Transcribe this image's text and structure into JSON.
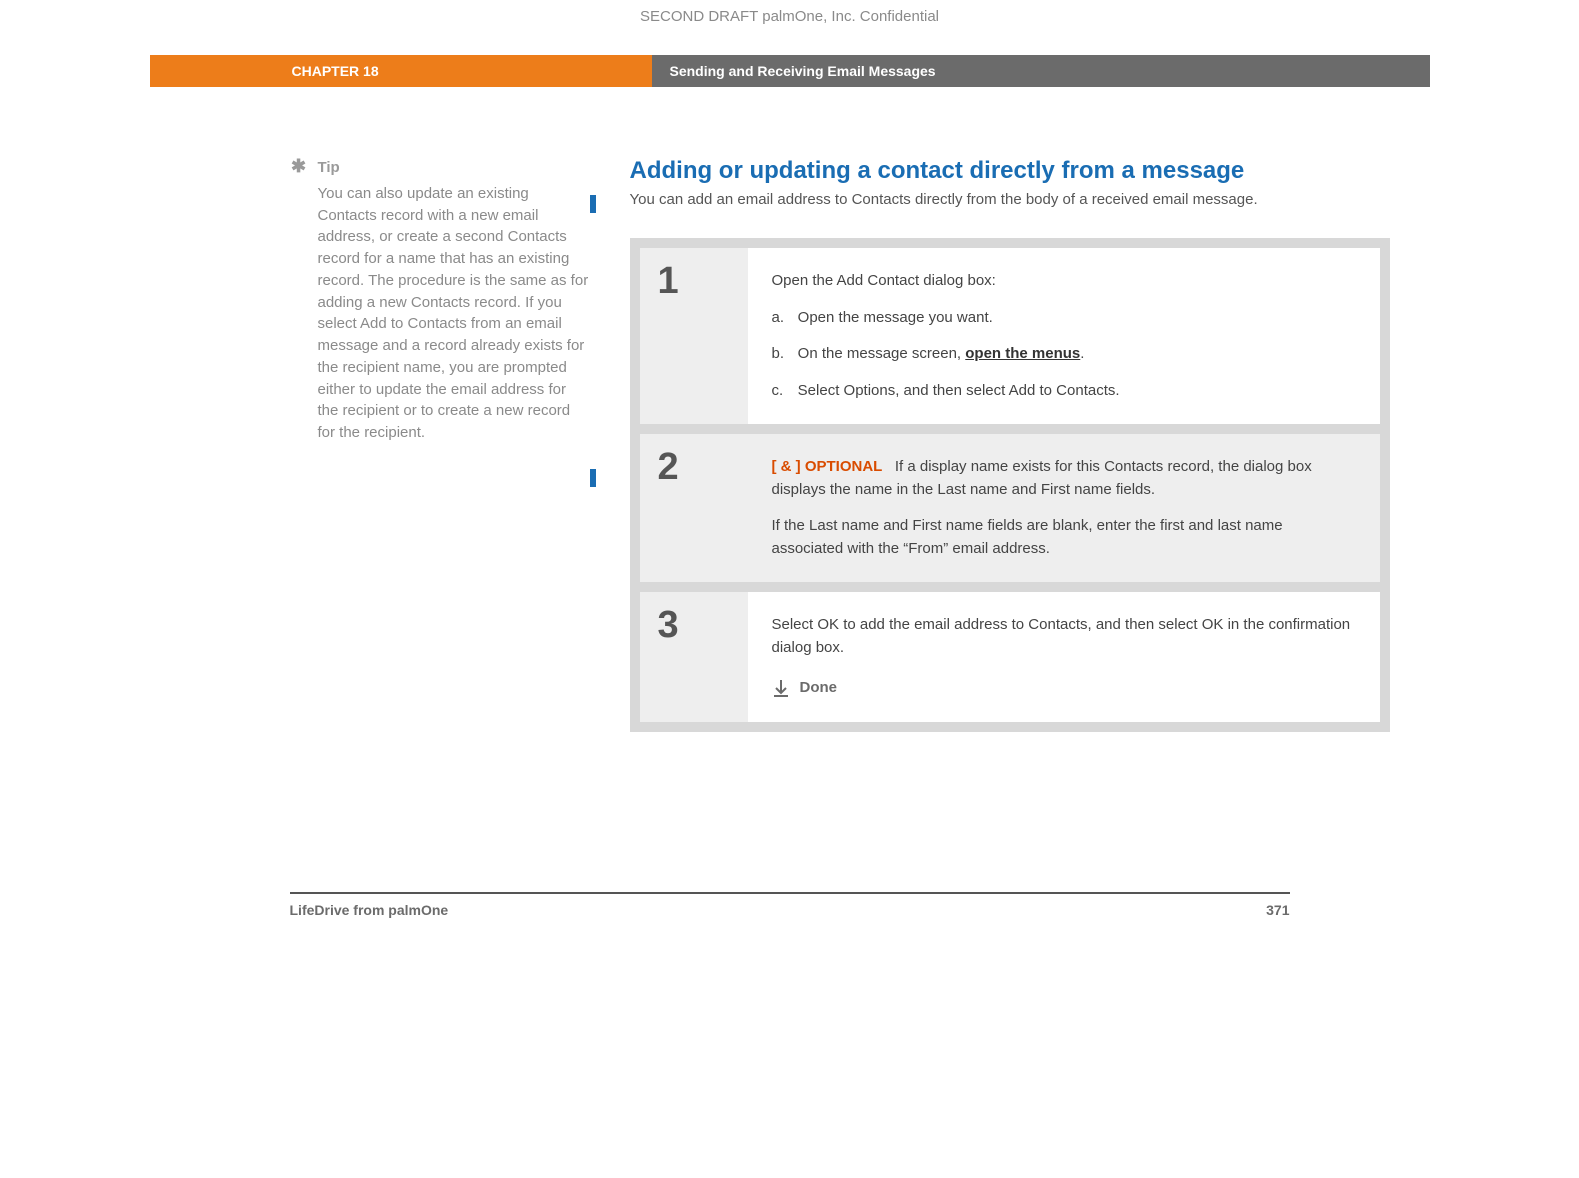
{
  "draft_header": "SECOND DRAFT palmOne, Inc.  Confidential",
  "chapter": {
    "label": "CHAPTER 18",
    "title": "Sending and Receiving Email Messages"
  },
  "tip": {
    "label": "Tip",
    "body": "You can also update an existing Contacts record with a new email address, or create a second Contacts record for a name that has an existing record. The procedure is the same as for adding a new Contacts record. If you select Add to Contacts from an email message and a record already exists for the recipient name, you are prompted either to update the email address for the recipient or to create a new record for the recipient."
  },
  "section": {
    "heading": "Adding or updating a contact directly from a message",
    "intro": "You can add an email address to Contacts directly from the body of a received email message."
  },
  "steps": {
    "s1": {
      "num": "1",
      "lead": "Open the Add Contact dialog box:",
      "a_letter": "a.",
      "a_text": "Open the message you want.",
      "b_letter": "b.",
      "b_prefix": "On the message screen, ",
      "b_link": "open the menus",
      "b_suffix": ".",
      "c_letter": "c.",
      "c_text": "Select Options, and then select Add to Contacts."
    },
    "s2": {
      "num": "2",
      "optional_tag": "[ & ]  OPTIONAL",
      "p1": "If a display name exists for this Contacts record, the dialog box displays the name in the Last name and First name fields.",
      "p2": "If the Last name and First name fields are blank, enter the first and last name associated with the “From” email address."
    },
    "s3": {
      "num": "3",
      "p1": "Select OK to add the email address to Contacts, and then select OK in the confirmation dialog box.",
      "done": "Done"
    }
  },
  "footer": {
    "product": "LifeDrive from palmOne",
    "page": "371"
  }
}
